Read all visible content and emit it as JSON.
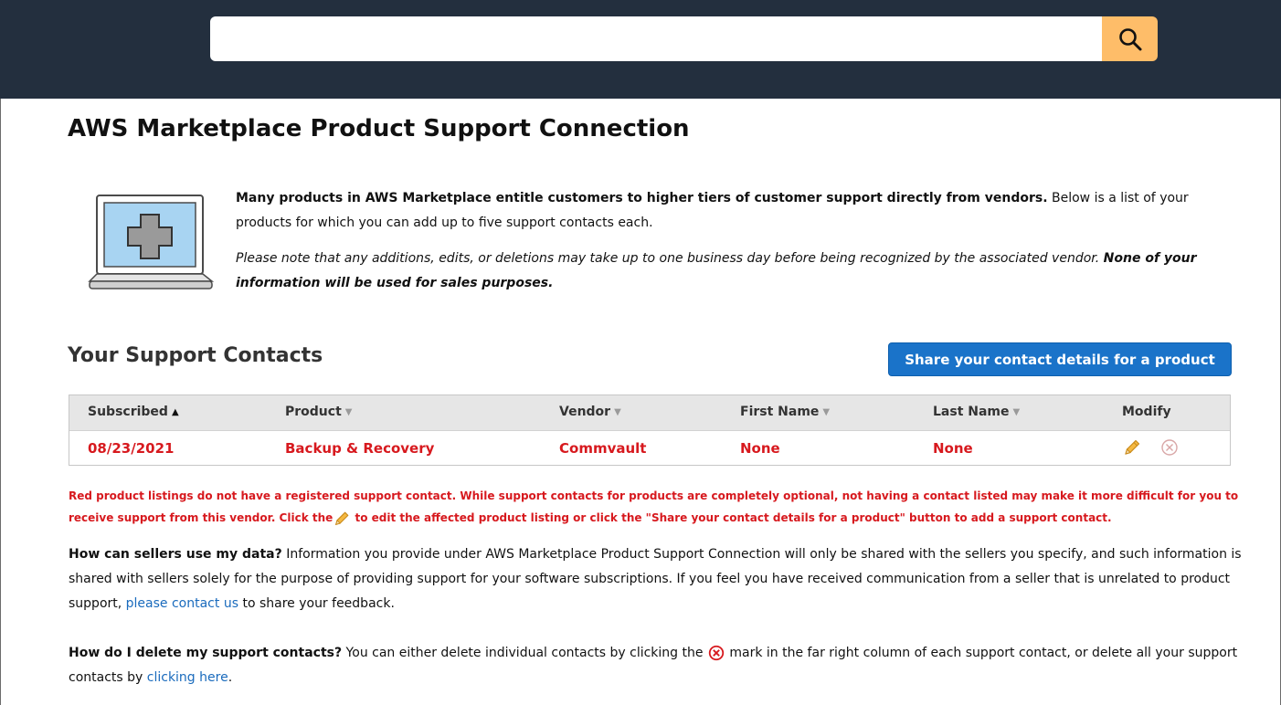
{
  "search": {
    "value": "",
    "placeholder": ""
  },
  "icons": {
    "search": "magnifier-icon",
    "laptop": "laptop-medical-cross-icon",
    "edit": "pencil-icon",
    "remove": "circle-x-icon"
  },
  "colors": {
    "header_bg": "#232f3e",
    "search_button": "#febd69",
    "accent_blue": "#1a73c9",
    "alert_red": "#d7191e",
    "link_blue": "#1a6bbd",
    "pencil_orange": "#f0a531"
  },
  "page": {
    "title": "AWS Marketplace Product Support Connection"
  },
  "intro": {
    "bold_lead": "Many products in AWS Marketplace entitle customers to higher tiers of customer support directly from vendors.",
    "rest": " Below is a list of your products for which you can add up to five support contacts each.",
    "note": "Please note that any additions, edits, or deletions may take up to one business day before being recognized by the associated vendor.",
    "note_bold": "None of your information will be used for sales purposes."
  },
  "contacts": {
    "section_title": "Your Support Contacts",
    "share_button": "Share your contact details for a product",
    "columns": [
      "Subscribed",
      "Product",
      "Vendor",
      "First Name",
      "Last Name",
      "Modify"
    ],
    "sort_indicators": [
      "▲",
      "▼",
      "▼",
      "▼",
      "▼"
    ],
    "rows": [
      {
        "subscribed": "08/23/2021",
        "product": "Backup & Recovery",
        "vendor": "Commvault",
        "first_name": "None",
        "last_name": "None"
      }
    ]
  },
  "warning": {
    "part1": "Red product listings do not have a registered support contact. While support contacts for products are completely optional, not having a contact listed may make it more difficult for you to receive support from this vendor. Click the",
    "part2": " to edit the affected product listing or click the \"Share your contact details for a product\" button to add a support contact."
  },
  "faq": {
    "q1": "How can sellers use my data?",
    "a1_before": " Information you provide under AWS Marketplace Product Support Connection will only be shared with the sellers you specify, and such information is shared with sellers solely for the purpose of providing support for your software subscriptions. If you feel you have received communication from a seller that is unrelated to product support, ",
    "a1_link": "please contact us",
    "a1_after": " to share your feedback.",
    "q2": "How do I delete my support contacts?",
    "a2_before": " You can either delete individual contacts by clicking the ",
    "a2_middle": " mark in the far right column of each support contact, or delete all your support contacts by ",
    "a2_link": "clicking here",
    "a2_after": "."
  }
}
